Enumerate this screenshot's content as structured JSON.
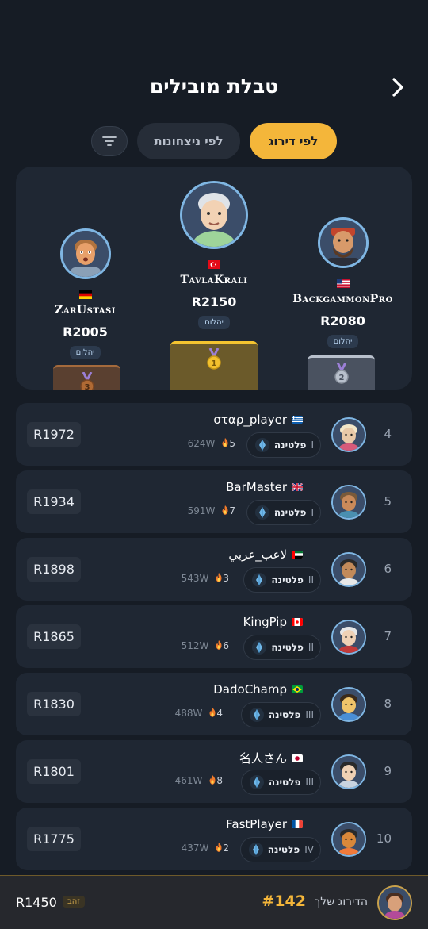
{
  "header": {
    "title": "טבלת מובילים",
    "back_icon": "chevron-right-icon"
  },
  "tabs": {
    "by_rank": "לפי דירוג",
    "by_wins": "לפי ניצחונות",
    "filter_icon": "filter-icon"
  },
  "podium": [
    {
      "place": 1,
      "name": "TavlaKrali",
      "rating": "R2150",
      "tier": "יהלום",
      "flag": "tr",
      "medal": "1"
    },
    {
      "place": 2,
      "name": "BackgammonPro",
      "rating": "R2080",
      "tier": "יהלום",
      "flag": "us",
      "medal": "2"
    },
    {
      "place": 3,
      "name": "ZarUstasi",
      "rating": "R2005",
      "tier": "יהלום",
      "flag": "de",
      "medal": "3"
    }
  ],
  "rows": [
    {
      "rank": "4",
      "name": "σταρ_player",
      "flag": "gr",
      "league": "פלטינה",
      "division": "I",
      "wins": "624W",
      "streak": "5",
      "rating": "R1972"
    },
    {
      "rank": "5",
      "name": "BarMaster",
      "flag": "gb",
      "league": "פלטינה",
      "division": "I",
      "wins": "591W",
      "streak": "7",
      "rating": "R1934"
    },
    {
      "rank": "6",
      "name": "لاعب_عربي",
      "flag": "ae",
      "league": "פלטינה",
      "division": "II",
      "wins": "543W",
      "streak": "3",
      "rating": "R1898"
    },
    {
      "rank": "7",
      "name": "KingPip",
      "flag": "ca",
      "league": "פלטינה",
      "division": "II",
      "wins": "512W",
      "streak": "6",
      "rating": "R1865"
    },
    {
      "rank": "8",
      "name": "DadoChamp",
      "flag": "br",
      "league": "פלטינה",
      "division": "III",
      "wins": "488W",
      "streak": "4",
      "rating": "R1830"
    },
    {
      "rank": "9",
      "name": "名人さん",
      "flag": "jp",
      "league": "פלטינה",
      "division": "III",
      "wins": "461W",
      "streak": "8",
      "rating": "R1801"
    },
    {
      "rank": "10",
      "name": "FastPlayer",
      "flag": "fr",
      "league": "פלטינה",
      "division": "IV",
      "wins": "437W",
      "streak": "2",
      "rating": "R1775"
    }
  ],
  "me": {
    "label": "הדירוג שלך",
    "rank": "#142",
    "tier": "זהב",
    "rating": "R1450"
  },
  "colors": {
    "accent": "#f4b63a",
    "card": "#1f2733",
    "background": "#161c25",
    "avatar_border": "#7fb6e3"
  }
}
